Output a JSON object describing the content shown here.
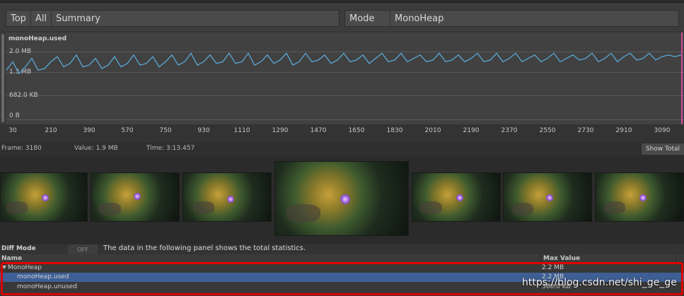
{
  "toolbar": {
    "top_label": "Top",
    "all_label": "All",
    "summary_label": "Summary",
    "mode_label": "Mode",
    "mode_value": "MonoHeap"
  },
  "chart": {
    "title": "monoHeap.used",
    "y_labels": [
      "2.0 MB",
      "1.3 MB",
      "682.0 KB",
      "0 B"
    ],
    "x_ticks": [
      "30",
      "210",
      "390",
      "570",
      "750",
      "930",
      "1110",
      "1290",
      "1470",
      "1650",
      "1830",
      "2010",
      "2190",
      "2370",
      "2550",
      "2730",
      "2910",
      "3090"
    ],
    "line_color": "#5aa7d6",
    "playhead_color": "#d34a9a"
  },
  "chart_data": {
    "type": "line",
    "title": "monoHeap.used",
    "xlabel": "",
    "ylabel": "",
    "xlim": [
      0,
      3180
    ],
    "ylim_mb": [
      0,
      2.0
    ],
    "y_ticks": [
      "0 B",
      "682.0 KB",
      "1.3 MB",
      "2.0 MB"
    ],
    "x_ticks": [
      30,
      210,
      390,
      570,
      750,
      930,
      1110,
      1290,
      1470,
      1650,
      1830,
      2010,
      2190,
      2370,
      2550,
      2730,
      2910,
      3090
    ],
    "series": [
      {
        "x": [
          0,
          30,
          60,
          90,
          120,
          150,
          180,
          210,
          240,
          270,
          300,
          330,
          360,
          390,
          420,
          450,
          480,
          510,
          540,
          570,
          600,
          630,
          660,
          690,
          720,
          750,
          780,
          810,
          840,
          870,
          900,
          930,
          960,
          990,
          1020,
          1050,
          1080,
          1110,
          1140,
          1170,
          1200,
          1230,
          1260,
          1290,
          1320,
          1350,
          1380,
          1410,
          1440,
          1470,
          1500,
          1530,
          1560,
          1590,
          1620,
          1650,
          1680,
          1710,
          1740,
          1770,
          1800,
          1830,
          1860,
          1890,
          1920,
          1950,
          1980,
          2010,
          2040,
          2070,
          2100,
          2130,
          2160,
          2190,
          2220,
          2250,
          2280,
          2310,
          2340,
          2370,
          2400,
          2430,
          2460,
          2490,
          2520,
          2550,
          2580,
          2610,
          2640,
          2670,
          2700,
          2730,
          2760,
          2790,
          2820,
          2850,
          2880,
          2910,
          2940,
          2970,
          3000,
          3030,
          3060,
          3090,
          3120,
          3150,
          3180
        ],
        "values": [
          1.45,
          1.7,
          1.35,
          1.55,
          1.8,
          1.45,
          1.5,
          1.7,
          1.85,
          1.55,
          1.65,
          1.9,
          1.55,
          1.6,
          1.8,
          1.5,
          1.6,
          1.85,
          1.55,
          1.65,
          1.9,
          1.6,
          1.65,
          1.85,
          1.55,
          1.7,
          1.9,
          1.6,
          1.7,
          1.95,
          1.6,
          1.7,
          1.9,
          1.65,
          1.7,
          1.95,
          1.65,
          1.7,
          1.95,
          1.6,
          1.7,
          1.9,
          1.65,
          1.75,
          1.95,
          1.6,
          1.7,
          1.95,
          1.7,
          1.75,
          1.9,
          1.65,
          1.75,
          1.95,
          1.7,
          1.75,
          1.9,
          1.65,
          1.8,
          1.95,
          1.7,
          1.75,
          1.95,
          1.7,
          1.8,
          1.9,
          1.7,
          1.75,
          1.95,
          1.7,
          1.75,
          1.9,
          1.7,
          1.8,
          1.95,
          1.7,
          1.75,
          1.95,
          1.7,
          1.8,
          1.95,
          1.7,
          1.8,
          1.9,
          1.7,
          1.8,
          1.95,
          1.7,
          1.8,
          1.9,
          1.75,
          1.8,
          1.95,
          1.7,
          1.8,
          1.95,
          1.7,
          1.85,
          1.95,
          1.75,
          1.8,
          1.95,
          1.75,
          1.85,
          1.9,
          1.85,
          1.9
        ]
      }
    ],
    "grid": true,
    "legend": "none"
  },
  "info": {
    "frame": "Frame: 3180",
    "value": "Value: 1.9 MB",
    "time": "Time: 3:13.457",
    "show_total": "Show Total"
  },
  "thumbnails_count": 7,
  "diff": {
    "label": "Diff Mode",
    "toggle": "OFF",
    "message": "The data in the following panel shows the total statistics."
  },
  "table": {
    "col_name": "Name",
    "col_max": "Max Value",
    "rows": [
      {
        "name": "MonoHeap",
        "value": "2.2 MB"
      },
      {
        "name": "monoHeap.used",
        "value": "2.2 MB"
      },
      {
        "name": "monoHeap.unused",
        "value": "360.0 KB"
      }
    ]
  },
  "watermark": "https://blog.csdn.net/shi_ge_ge"
}
